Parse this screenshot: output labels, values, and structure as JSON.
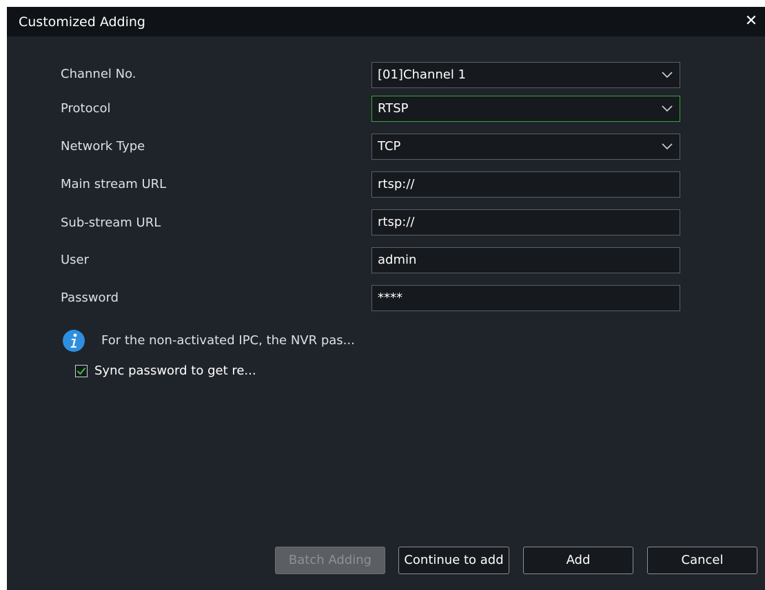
{
  "dialog": {
    "title": "Customized Adding",
    "close_symbol": "✕"
  },
  "form": {
    "channel_no": {
      "label": "Channel No.",
      "value": "[01]Channel 1"
    },
    "protocol": {
      "label": "Protocol",
      "value": "RTSP"
    },
    "network_type": {
      "label": "Network Type",
      "value": "TCP"
    },
    "main_stream_url": {
      "label": "Main stream URL",
      "value": "rtsp://"
    },
    "sub_stream_url": {
      "label": "Sub-stream URL",
      "value": "rtsp://"
    },
    "user": {
      "label": "User",
      "value": "admin"
    },
    "password": {
      "label": "Password",
      "value": "****"
    }
  },
  "info": {
    "icon": "info-icon",
    "text": "For the non-activated IPC, the NVR pas..."
  },
  "sync": {
    "checked": true,
    "label": "Sync password to get re..."
  },
  "buttons": {
    "batch_adding": "Batch Adding",
    "continue_to_add": "Continue to add",
    "add": "Add",
    "cancel": "Cancel"
  },
  "colors": {
    "background": "#1f242a",
    "titlebar": "#0f1216",
    "focus_border": "#37a63a",
    "check": "#3cc43c",
    "info_blue": "#2e8fe0"
  }
}
